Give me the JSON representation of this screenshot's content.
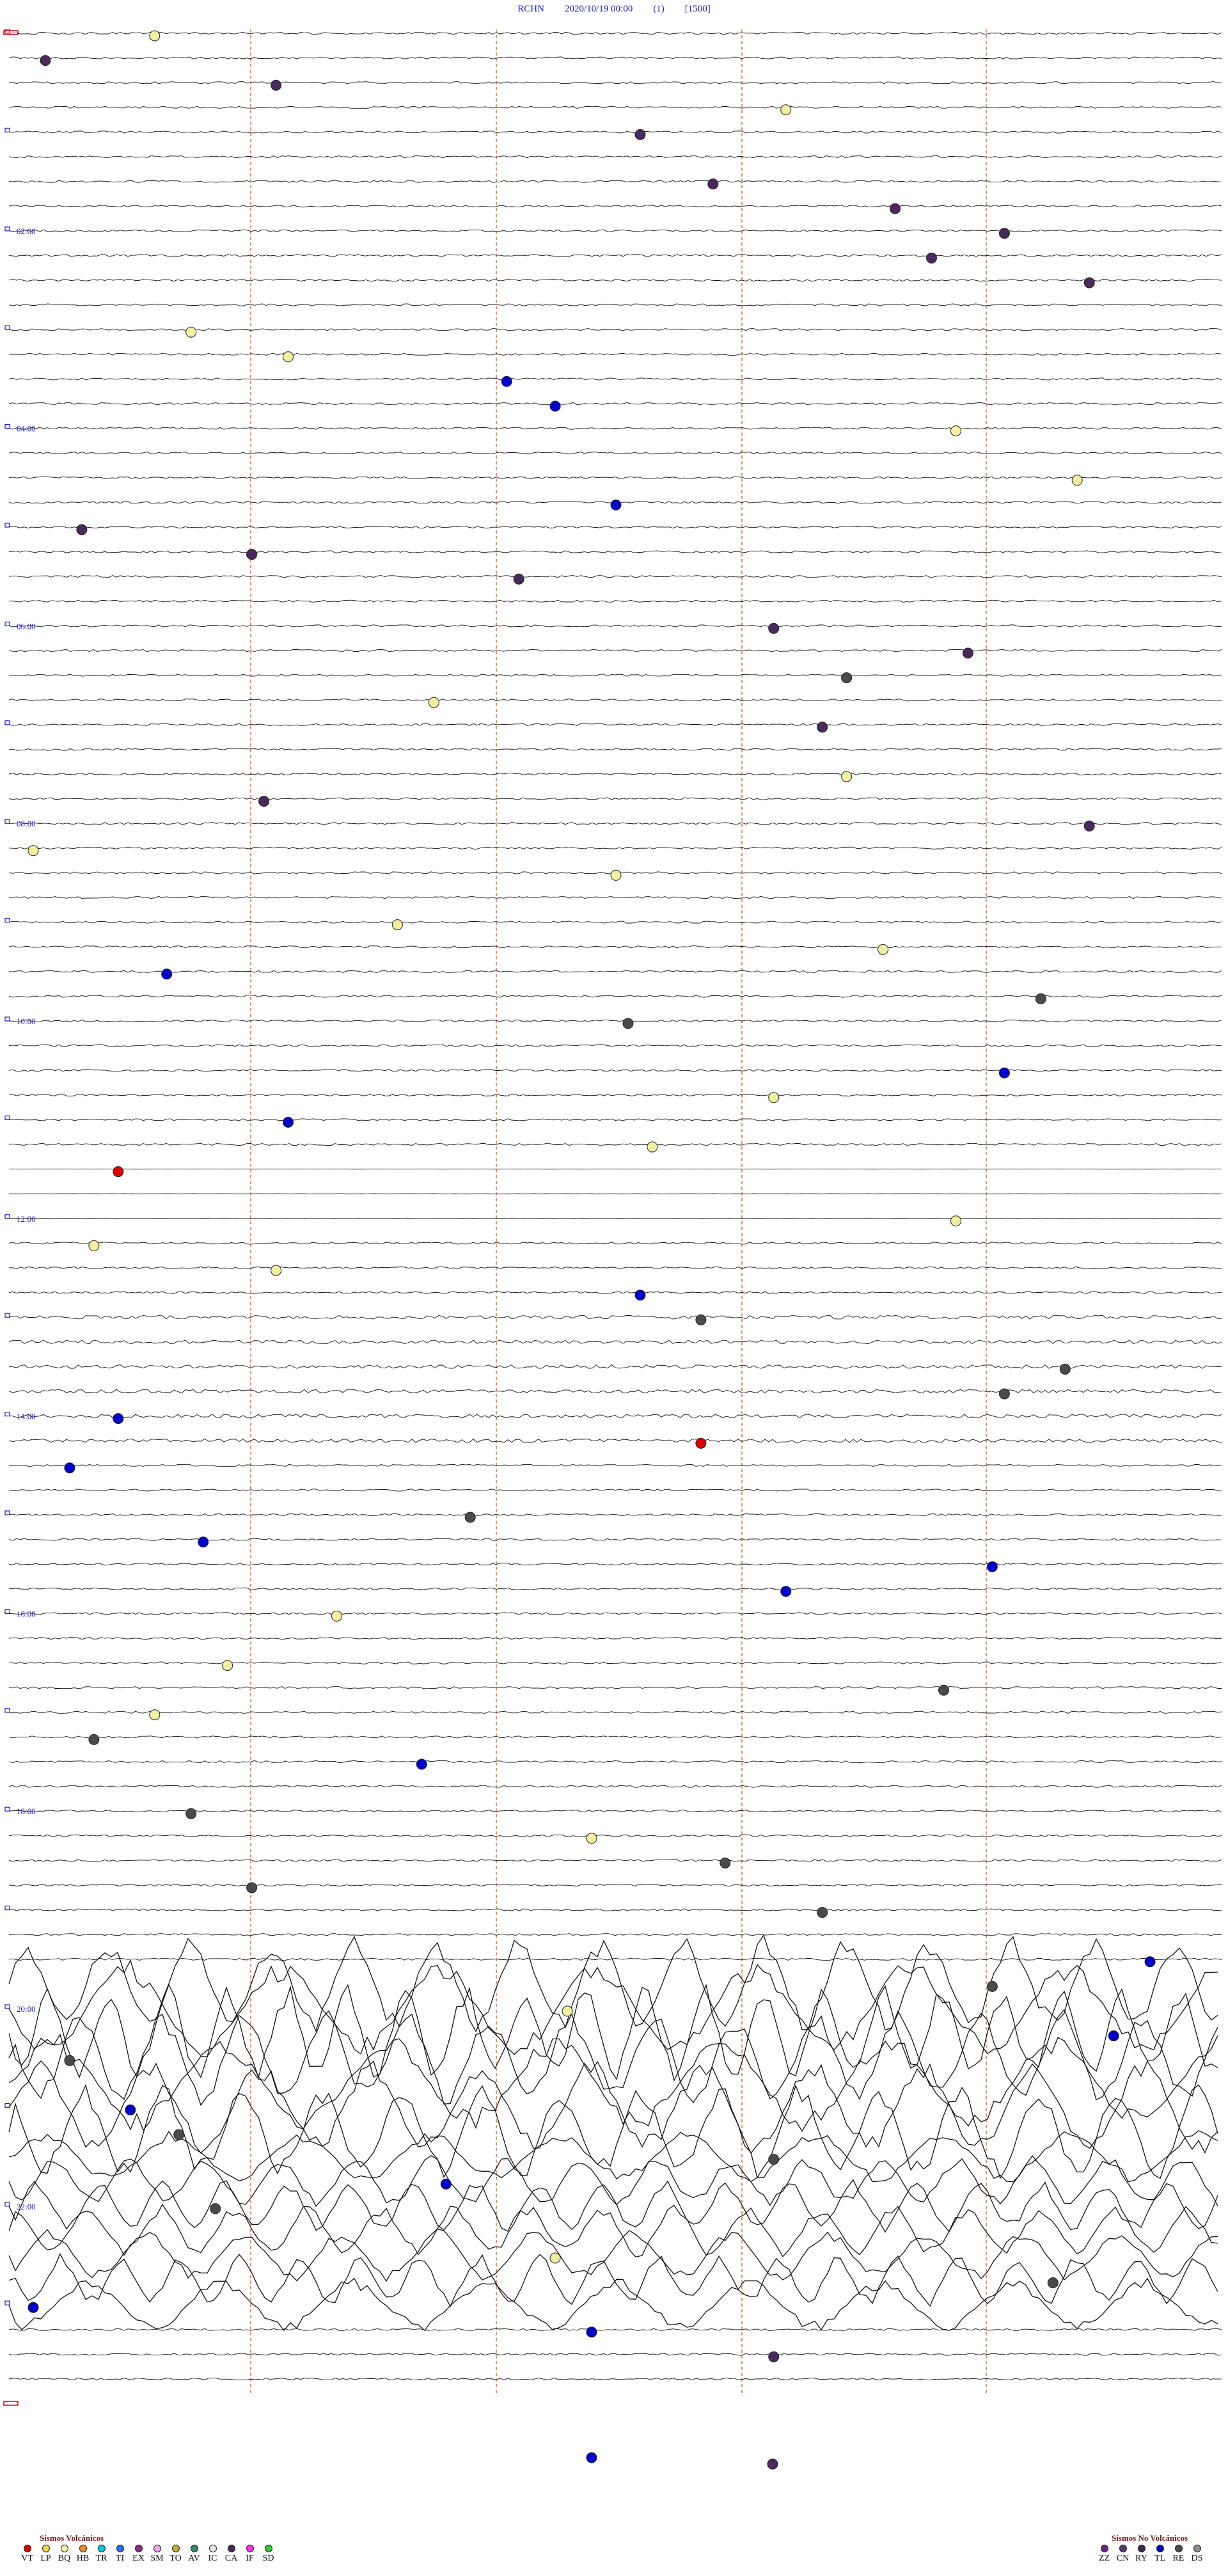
{
  "header": {
    "station": "RCHN",
    "datetime": "2020/10/19 00:00",
    "channel": "(1)",
    "gain": "[1500]"
  },
  "time_labels": [
    "02:00",
    "04:00",
    "06:00",
    "08:00",
    "10:00",
    "12:00",
    "14:00",
    "16:00",
    "18:00",
    "20:00",
    "22:00"
  ],
  "colors": {
    "trace": "#111111",
    "hour_marker": "#1a1acc",
    "gridline": "#e07a3a",
    "row_marker_red": "#cc0000",
    "row_marker_green": "#1a9a1a"
  },
  "legend_volcanic": {
    "title": "Sismos Volcánicos",
    "items": [
      {
        "code": "VT",
        "color": "#dd0000"
      },
      {
        "code": "LP",
        "color": "#e8d84a"
      },
      {
        "code": "BQ",
        "color": "#f0f0a0"
      },
      {
        "code": "HB",
        "color": "#f08a20"
      },
      {
        "code": "TR",
        "color": "#00c8e0"
      },
      {
        "code": "TI",
        "color": "#2a6ef0"
      },
      {
        "code": "EX",
        "color": "#8a2a8a"
      },
      {
        "code": "SM",
        "color": "#e8a8e8"
      },
      {
        "code": "TO",
        "color": "#c8a838"
      },
      {
        "code": "AV",
        "color": "#2a8a6a"
      },
      {
        "code": "IC",
        "color": "#e8e8e8"
      },
      {
        "code": "CA",
        "color": "#4a2a5a"
      },
      {
        "code": "IF",
        "color": "#ff30ff"
      },
      {
        "code": "SD",
        "color": "#30c830"
      }
    ]
  },
  "legend_tectonic": {
    "title": "Sismos No Volcánicos",
    "items": [
      {
        "code": "ZZ",
        "color": "#6a2a8a"
      },
      {
        "code": "CN",
        "color": "#5a3a6a"
      },
      {
        "code": "RY",
        "color": "#3a2a4a"
      },
      {
        "code": "TL",
        "color": "#0000cc"
      },
      {
        "code": "RE",
        "color": "#4a4a4a"
      },
      {
        "code": "DS",
        "color": "#8a8a8a"
      }
    ]
  },
  "events": [
    {
      "type": "BQ",
      "t": 0.12
    },
    {
      "type": "CA",
      "t": 0.03
    },
    {
      "type": "CA",
      "t": 0.22
    },
    {
      "type": "BQ",
      "t": 0.64
    },
    {
      "type": "CA",
      "t": 0.52
    },
    {
      "type": "CA",
      "t": 0.58
    },
    {
      "type": "CA",
      "t": 0.73
    },
    {
      "type": "CA",
      "t": 0.82
    },
    {
      "type": "CA",
      "t": 0.76
    },
    {
      "type": "CA",
      "t": 0.89
    },
    {
      "type": "BQ",
      "t": 0.15
    },
    {
      "type": "BQ",
      "t": 0.23
    },
    {
      "type": "TL",
      "t": 0.41
    },
    {
      "type": "TL",
      "t": 0.45
    },
    {
      "type": "BQ",
      "t": 0.78
    },
    {
      "type": "BQ",
      "t": 0.88
    },
    {
      "type": "TL",
      "t": 0.5
    },
    {
      "type": "CA",
      "t": 0.06
    },
    {
      "type": "CA",
      "t": 0.2
    },
    {
      "type": "CA",
      "t": 0.42
    },
    {
      "type": "CA",
      "t": 0.63
    },
    {
      "type": "CA",
      "t": 0.79
    },
    {
      "type": "RE",
      "t": 0.69
    },
    {
      "type": "BQ",
      "t": 0.35
    },
    {
      "type": "CA",
      "t": 0.67
    },
    {
      "type": "BQ",
      "t": 0.69
    },
    {
      "type": "CA",
      "t": 0.21
    },
    {
      "type": "CA",
      "t": 0.89
    },
    {
      "type": "BQ",
      "t": 0.02
    },
    {
      "type": "BQ",
      "t": 0.5
    },
    {
      "type": "BQ",
      "t": 0.32
    },
    {
      "type": "BQ",
      "t": 0.72
    },
    {
      "type": "TL",
      "t": 0.13
    },
    {
      "type": "RE",
      "t": 0.85
    },
    {
      "type": "RE",
      "t": 0.51
    },
    {
      "type": "TL",
      "t": 0.82
    },
    {
      "type": "BQ",
      "t": 0.63
    },
    {
      "type": "TL",
      "t": 0.23
    },
    {
      "type": "BQ",
      "t": 0.53
    },
    {
      "type": "VT",
      "t": 0.09
    },
    {
      "type": "BQ",
      "t": 0.78
    },
    {
      "type": "BQ",
      "t": 0.07
    },
    {
      "type": "BQ",
      "t": 0.22
    },
    {
      "type": "TL",
      "t": 0.52
    },
    {
      "type": "RE",
      "t": 0.57
    },
    {
      "type": "RE",
      "t": 0.87
    },
    {
      "type": "RE",
      "t": 0.82
    },
    {
      "type": "TL",
      "t": 0.09
    },
    {
      "type": "VT",
      "t": 0.57
    },
    {
      "type": "TL",
      "t": 0.05
    },
    {
      "type": "RE",
      "t": 0.38
    },
    {
      "type": "TL",
      "t": 0.16
    },
    {
      "type": "TL",
      "t": 0.81
    },
    {
      "type": "TL",
      "t": 0.64
    },
    {
      "type": "BQ",
      "t": 0.27
    },
    {
      "type": "BQ",
      "t": 0.18
    },
    {
      "type": "RE",
      "t": 0.77
    },
    {
      "type": "BQ",
      "t": 0.12
    },
    {
      "type": "RE",
      "t": 0.07
    },
    {
      "type": "TL",
      "t": 0.34
    },
    {
      "type": "RE",
      "t": 0.15
    },
    {
      "type": "BQ",
      "t": 0.48
    },
    {
      "type": "RE",
      "t": 0.59
    },
    {
      "type": "RE",
      "t": 0.2
    },
    {
      "type": "RE",
      "t": 0.67
    },
    {
      "type": "TL",
      "t": 0.94
    },
    {
      "type": "RE",
      "t": 0.81
    },
    {
      "type": "BQ",
      "t": 0.46
    },
    {
      "type": "TL",
      "t": 0.91
    },
    {
      "type": "RE",
      "t": 0.05
    },
    {
      "type": "TL",
      "t": 0.1
    },
    {
      "type": "RE",
      "t": 0.14
    },
    {
      "type": "RE",
      "t": 0.63
    },
    {
      "type": "TL",
      "t": 0.36
    },
    {
      "type": "RE",
      "t": 0.17
    },
    {
      "type": "BQ",
      "t": 0.45
    },
    {
      "type": "RE",
      "t": 0.86
    },
    {
      "type": "TL",
      "t": 0.02
    },
    {
      "type": "TL",
      "t": 0.48
    },
    {
      "type": "CA",
      "t": 0.63
    }
  ]
}
